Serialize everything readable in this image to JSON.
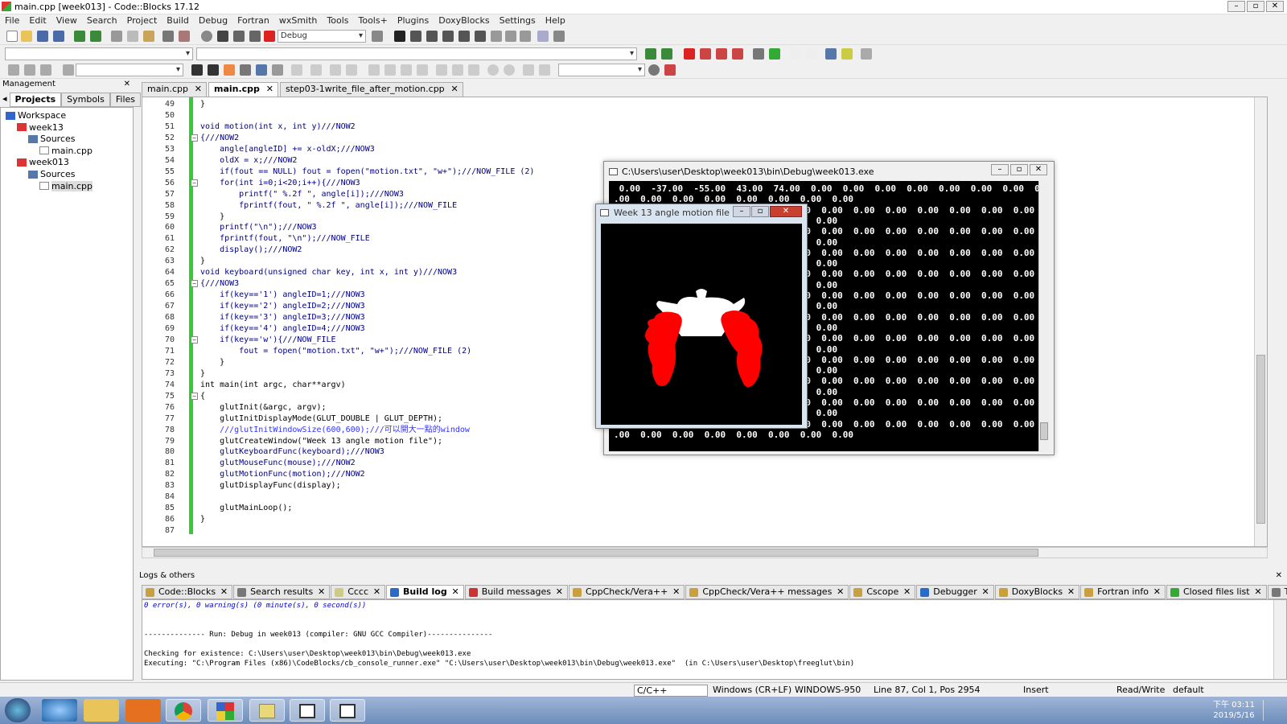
{
  "window": {
    "title": "main.cpp [week013] - Code::Blocks 17.12"
  },
  "menu": [
    "File",
    "Edit",
    "View",
    "Search",
    "Project",
    "Build",
    "Debug",
    "Fortran",
    "wxSmith",
    "Tools",
    "Tools+",
    "Plugins",
    "DoxyBlocks",
    "Settings",
    "Help"
  ],
  "toolbar": {
    "build_target": "Debug"
  },
  "management": {
    "title": "Management",
    "tabs": [
      "Projects",
      "Symbols",
      "Files"
    ],
    "tree": [
      {
        "label": "Workspace",
        "indent": 0
      },
      {
        "label": "week13",
        "indent": 1
      },
      {
        "label": "Sources",
        "indent": 2
      },
      {
        "label": "main.cpp",
        "indent": 3
      },
      {
        "label": "week013",
        "indent": 1
      },
      {
        "label": "Sources",
        "indent": 2
      },
      {
        "label": "main.cpp",
        "indent": 3
      }
    ]
  },
  "editor": {
    "tabs": [
      "main.cpp",
      "main.cpp",
      "step03-1write_file_after_motion.cpp"
    ],
    "active_tab": 1,
    "lines": [
      {
        "n": "49",
        "t": "}"
      },
      {
        "n": "50",
        "t": ""
      },
      {
        "n": "51",
        "t": "void motion(int x, int y)///NOW2"
      },
      {
        "n": "52",
        "t": "{///NOW2"
      },
      {
        "n": "53",
        "t": "    angle[angleID] += x-oldX;///NOW3"
      },
      {
        "n": "54",
        "t": "    oldX = x;///NOW2"
      },
      {
        "n": "55",
        "t": "    if(fout == NULL) fout = fopen(\"motion.txt\", \"w+\");///NOW_FILE (2)"
      },
      {
        "n": "56",
        "t": "    for(int i=0;i<20;i++){///NOW3"
      },
      {
        "n": "57",
        "t": "        printf(\" %.2f \", angle[i]);///NOW3"
      },
      {
        "n": "58",
        "t": "        fprintf(fout, \" %.2f \", angle[i]);///NOW_FILE"
      },
      {
        "n": "59",
        "t": "    }"
      },
      {
        "n": "60",
        "t": "    printf(\"\\n\");///NOW3"
      },
      {
        "n": "61",
        "t": "    fprintf(fout, \"\\n\");///NOW_FILE"
      },
      {
        "n": "62",
        "t": "    display();///NOW2"
      },
      {
        "n": "63",
        "t": "}"
      },
      {
        "n": "64",
        "t": "void keyboard(unsigned char key, int x, int y)///NOW3"
      },
      {
        "n": "65",
        "t": "{///NOW3"
      },
      {
        "n": "66",
        "t": "    if(key=='1') angleID=1;///NOW3"
      },
      {
        "n": "67",
        "t": "    if(key=='2') angleID=2;///NOW3"
      },
      {
        "n": "68",
        "t": "    if(key=='3') angleID=3;///NOW3"
      },
      {
        "n": "69",
        "t": "    if(key=='4') angleID=4;///NOW3"
      },
      {
        "n": "70",
        "t": "    if(key=='w'){///NOW_FILE"
      },
      {
        "n": "71",
        "t": "        fout = fopen(\"motion.txt\", \"w+\");///NOW_FILE (2)"
      },
      {
        "n": "72",
        "t": "    }"
      },
      {
        "n": "73",
        "t": "}"
      },
      {
        "n": "74",
        "t": "int main(int argc, char**argv)"
      },
      {
        "n": "75",
        "t": "{"
      },
      {
        "n": "76",
        "t": "    glutInit(&argc, argv);"
      },
      {
        "n": "77",
        "t": "    glutInitDisplayMode(GLUT_DOUBLE | GLUT_DEPTH);"
      },
      {
        "n": "78",
        "t": "    ///glutInitWindowSize(600,600);///可以開大一點的window"
      },
      {
        "n": "79",
        "t": "    glutCreateWindow(\"Week 13 angle motion file\");"
      },
      {
        "n": "80",
        "t": "    glutKeyboardFunc(keyboard);///NOW3"
      },
      {
        "n": "81",
        "t": "    glutMouseFunc(mouse);///NOW2"
      },
      {
        "n": "82",
        "t": "    glutMotionFunc(motion);///NOW2"
      },
      {
        "n": "83",
        "t": "    glutDisplayFunc(display);"
      },
      {
        "n": "84",
        "t": ""
      },
      {
        "n": "85",
        "t": "    glutMainLoop();"
      },
      {
        "n": "86",
        "t": "}"
      },
      {
        "n": "87",
        "t": ""
      }
    ]
  },
  "console": {
    "title": "C:\\Users\\user\\Desktop\\week013\\bin\\Debug\\week013.exe",
    "lines": [
      " 0.00  -37.00  -55.00  43.00  74.00  0.00  0.00  0.00  0.00  0.00  0.00  0.00  0",
      ".00  0.00  0.00  0.00  0.00  0.00  0.00  0.00",
      "                                  .00  0.00  0.00  0.00  0.00  0.00  0.00  0.00  0",
      "                                  00  0.00",
      "                                  .00  0.00  0.00  0.00  0.00  0.00  0.00  0.00  0",
      "                                  00  0.00",
      "                                  .00  0.00  0.00  0.00  0.00  0.00  0.00  0.00  0",
      "                                  00  0.00",
      "                                  .00  0.00  0.00  0.00  0.00  0.00  0.00  0.00  0",
      "                                  00  0.00",
      "                                  .00  0.00  0.00  0.00  0.00  0.00  0.00  0.00  0",
      "                                  00  0.00",
      "                                  .00  0.00  0.00  0.00  0.00  0.00  0.00  0.00  0",
      "                                  00  0.00",
      "                                  .00  0.00  0.00  0.00  0.00  0.00  0.00  0.00  0",
      "                                  00  0.00",
      "                                  .00  0.00  0.00  0.00  0.00  0.00  0.00  0.00  0",
      "                                  00  0.00",
      "                                  .00  0.00  0.00  0.00  0.00  0.00  0.00  0.00  0",
      "                                  00  0.00",
      "                                  .00  0.00  0.00  0.00  0.00  0.00  0.00  0.00  0",
      "                                  00  0.00",
      "                                  .00  0.00  0.00  0.00  0.00  0.00  0.00  0.00  0",
      ".00  0.00  0.00  0.00  0.00  0.00  0.00  0.00"
    ]
  },
  "glut_window": {
    "title": "Week 13 angle motion file"
  },
  "logs": {
    "title": "Logs & others",
    "tabs": [
      "Code::Blocks",
      "Search results",
      "Cccc",
      "Build log",
      "Build messages",
      "CppCheck/Vera++",
      "CppCheck/Vera++ messages",
      "Cscope",
      "Debugger",
      "DoxyBlocks",
      "Fortran info",
      "Closed files list",
      "Thread"
    ],
    "active_tab": 3,
    "lines": [
      "0 error(s), 0 warning(s) (0 minute(s), 0 second(s))",
      "",
      "",
      "-------------- Run: Debug in week013 (compiler: GNU GCC Compiler)---------------",
      "",
      "Checking for existence: C:\\Users\\user\\Desktop\\week013\\bin\\Debug\\week013.exe",
      "Executing: \"C:\\Program Files (x86)\\CodeBlocks/cb_console_runner.exe\" \"C:\\Users\\user\\Desktop\\week013\\bin\\Debug\\week013.exe\"  (in C:\\Users\\user\\Desktop\\freeglut\\bin)"
    ]
  },
  "status": {
    "lang": "C/C++",
    "eol": "Windows (CR+LF)",
    "encoding": "WINDOWS-950",
    "position": "Line 87, Col 1, Pos 2954",
    "mode": "Insert",
    "access": "Read/Write",
    "profile": "default"
  },
  "taskbar": {
    "time": "下午 03:11",
    "date": "2019/5/16"
  },
  "colors": {
    "accent_green": "#33cc33",
    "teapot_red": "#ff0000",
    "keyword": "#000080",
    "comment": "#3232ff",
    "string": "#0000ff"
  }
}
